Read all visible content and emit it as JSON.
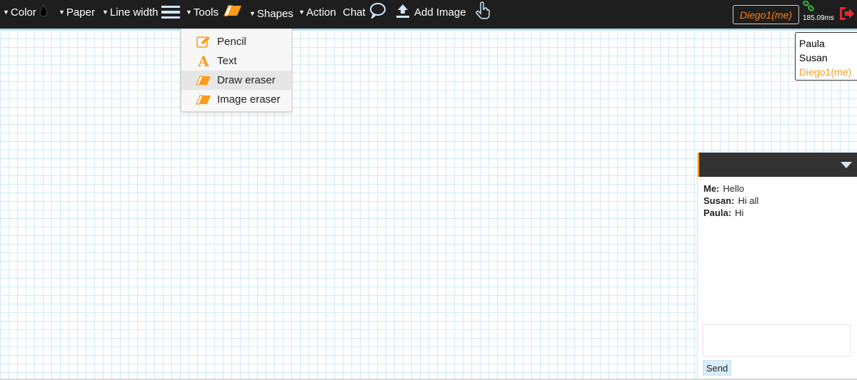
{
  "toolbar": {
    "color_label": "Color",
    "paper_label": "Paper",
    "line_width_label": "Line width",
    "tools_label": "Tools",
    "shapes_label": "Shapes",
    "action_label": "Action",
    "chat_label": "Chat",
    "add_image_label": "Add Image",
    "current_user": "Diego1(me)",
    "latency": "185.09ms"
  },
  "tools_menu": {
    "items": [
      {
        "label": "Pencil",
        "icon": "pencil-icon"
      },
      {
        "label": "Text",
        "icon": "text-icon"
      },
      {
        "label": "Draw eraser",
        "icon": "eraser-icon"
      },
      {
        "label": "Image eraser",
        "icon": "eraser-icon"
      }
    ],
    "active_index": 2
  },
  "users": [
    "Paula",
    "Susan",
    "Diego1(me)"
  ],
  "chat": {
    "messages": [
      {
        "sender": "Me:",
        "text": "Hello"
      },
      {
        "sender": "Susan:",
        "text": "Hi all"
      },
      {
        "sender": "Paula:",
        "text": "Hi"
      }
    ],
    "input_value": "",
    "send_label": "Send"
  },
  "colors": {
    "toolbar_bg": "#1e1e1e",
    "accent": "#ff9a1a",
    "grid_line": "#cfeaf7",
    "exit": "#e8262b",
    "link": "#37c43a"
  }
}
